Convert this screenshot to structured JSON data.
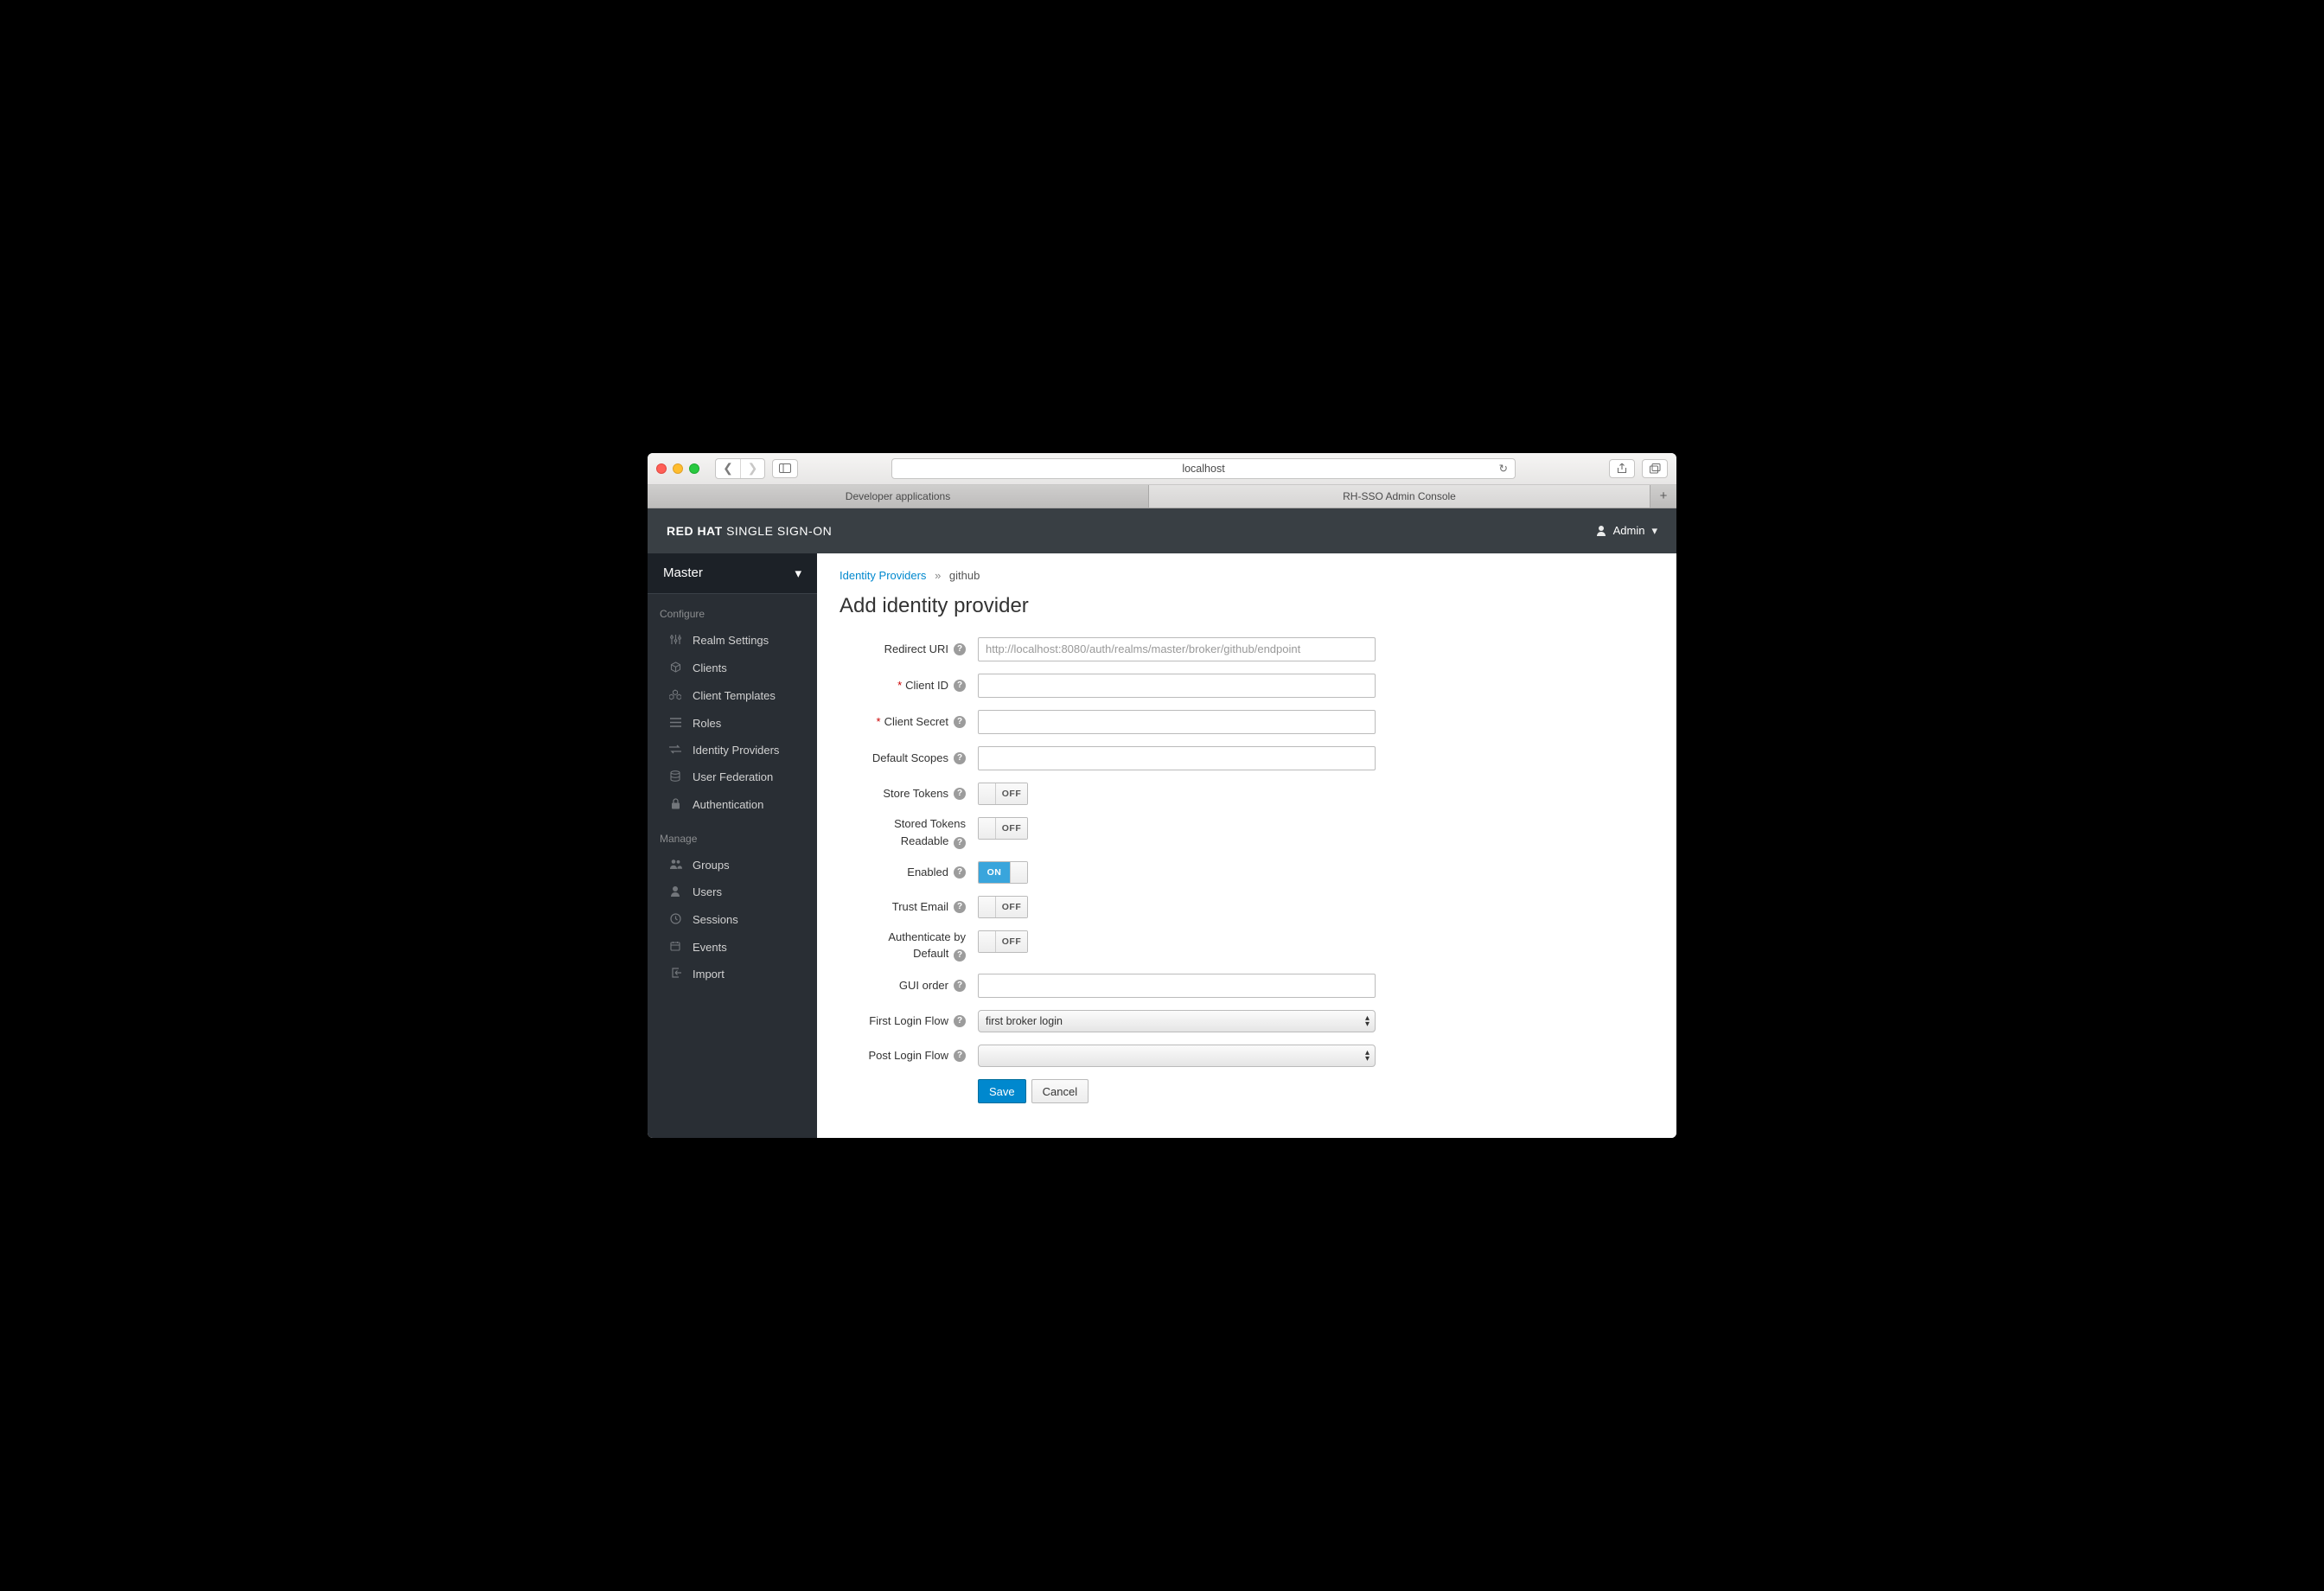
{
  "browser": {
    "address": "localhost",
    "tabs": [
      "Developer applications",
      "RH-SSO Admin Console"
    ],
    "active_tab": 1
  },
  "header": {
    "brand_bold": "RED HAT",
    "brand_rest": " SINGLE SIGN-ON",
    "user": "Admin"
  },
  "sidebar": {
    "realm": "Master",
    "sections": [
      {
        "title": "Configure",
        "items": [
          {
            "label": "Realm Settings"
          },
          {
            "label": "Clients"
          },
          {
            "label": "Client Templates"
          },
          {
            "label": "Roles"
          },
          {
            "label": "Identity Providers"
          },
          {
            "label": "User Federation"
          },
          {
            "label": "Authentication"
          }
        ]
      },
      {
        "title": "Manage",
        "items": [
          {
            "label": "Groups"
          },
          {
            "label": "Users"
          },
          {
            "label": "Sessions"
          },
          {
            "label": "Events"
          },
          {
            "label": "Import"
          }
        ]
      }
    ]
  },
  "breadcrumb": {
    "root": "Identity Providers",
    "current": "github"
  },
  "page": {
    "title": "Add identity provider"
  },
  "form": {
    "redirect_uri": {
      "label": "Redirect URI",
      "value": "http://localhost:8080/auth/realms/master/broker/github/endpoint"
    },
    "client_id": {
      "label": "Client ID",
      "required": true,
      "value": ""
    },
    "client_secret": {
      "label": "Client Secret",
      "required": true,
      "value": ""
    },
    "default_scopes": {
      "label": "Default Scopes",
      "value": ""
    },
    "store_tokens": {
      "label": "Store Tokens",
      "value": "OFF"
    },
    "stored_tokens_readable": {
      "label_l1": "Stored Tokens",
      "label_l2": "Readable",
      "value": "OFF"
    },
    "enabled": {
      "label": "Enabled",
      "value": "ON"
    },
    "trust_email": {
      "label": "Trust Email",
      "value": "OFF"
    },
    "auth_by_default": {
      "label_l1": "Authenticate by",
      "label_l2": "Default",
      "value": "OFF"
    },
    "gui_order": {
      "label": "GUI order",
      "value": ""
    },
    "first_login_flow": {
      "label": "First Login Flow",
      "value": "first broker login"
    },
    "post_login_flow": {
      "label": "Post Login Flow",
      "value": ""
    }
  },
  "buttons": {
    "save": "Save",
    "cancel": "Cancel"
  },
  "toggle_text": {
    "on": "ON",
    "off": "OFF"
  }
}
